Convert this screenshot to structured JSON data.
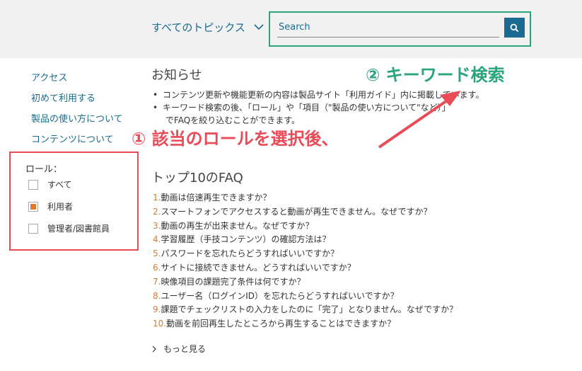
{
  "header": {
    "topics_label": "すべてのトピックス",
    "search_placeholder": "Search"
  },
  "sidebar": {
    "links": [
      "アクセス",
      "初めて利用する",
      "製品の使い方について",
      "コンテンツについて"
    ],
    "role_title": "ロール：",
    "roles": [
      {
        "label": "すべて",
        "checked": false
      },
      {
        "label": "利用者",
        "checked": true
      },
      {
        "label": "管理者/図書館員",
        "checked": false
      }
    ]
  },
  "news": {
    "title": "お知らせ",
    "items": [
      {
        "bullet": "•",
        "lines": [
          "コンテンツ更新や機能更新の内容は製品サイト「利用ガイド」内に掲載しています。"
        ]
      },
      {
        "bullet": "•",
        "lines": [
          "キーワード検索の後、「ロール」や「項目（\"製品の使い方について\"など）」",
          "でFAQを絞り込むことができます。"
        ]
      }
    ]
  },
  "faq": {
    "title": "トップ10のFAQ",
    "items": [
      {
        "num": "1.",
        "text": "動画は倍速再生できますか？"
      },
      {
        "num": "2.",
        "text": "スマートフォンでアクセスすると動画が再生できません。なぜですか？"
      },
      {
        "num": "3.",
        "text": "動画の再生が出来ません。なぜですか？"
      },
      {
        "num": "4.",
        "text": "学習履歴（手技コンテンツ）の確認方法は？"
      },
      {
        "num": "5.",
        "text": "パスワードを忘れたらどうすればいいですか？"
      },
      {
        "num": "6.",
        "text": "サイトに接続できません。どうすればいいですか？"
      },
      {
        "num": "7.",
        "text": "映像項目の課題完了条件は何ですか？"
      },
      {
        "num": "8.",
        "text": "ユーザー名（ログインID）を忘れたらどうすればいいですか？"
      },
      {
        "num": "9.",
        "text": "課題でチェックリストの入力をしたのに「完了」となりません。なぜですか？"
      },
      {
        "num": "10.",
        "text": "動画を前回再生したところから再生することはできますか？"
      }
    ],
    "more_label": "もっと見る"
  },
  "annotations": {
    "step1": "① 該当のロールを選択後、",
    "step2": "② キーワード検索"
  },
  "colors": {
    "accent": "#1a6a91",
    "number": "#e07a2a",
    "annotation_red": "#e94b57",
    "annotation_green": "#2aa57a"
  }
}
